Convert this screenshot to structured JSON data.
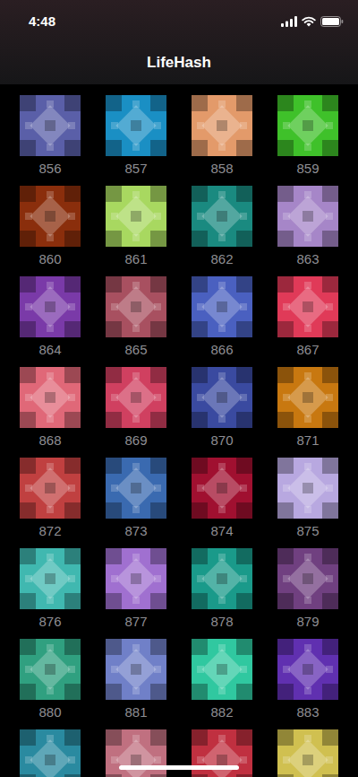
{
  "status_bar": {
    "time": "4:48"
  },
  "nav": {
    "title": "LifeHash"
  },
  "tiles": [
    {
      "number": "856",
      "color": "#5a5fa8"
    },
    {
      "number": "857",
      "color": "#1a8fc4"
    },
    {
      "number": "858",
      "color": "#e39a6a"
    },
    {
      "number": "859",
      "color": "#3fc12a"
    },
    {
      "number": "860",
      "color": "#8a2e0c"
    },
    {
      "number": "861",
      "color": "#a8d860"
    },
    {
      "number": "862",
      "color": "#1a8a80"
    },
    {
      "number": "863",
      "color": "#a686c8"
    },
    {
      "number": "864",
      "color": "#7a3aa8"
    },
    {
      "number": "865",
      "color": "#a85060"
    },
    {
      "number": "866",
      "color": "#4a60c0"
    },
    {
      "number": "867",
      "color": "#e03a58"
    },
    {
      "number": "868",
      "color": "#e06878"
    },
    {
      "number": "869",
      "color": "#d04060"
    },
    {
      "number": "870",
      "color": "#3a4aa0"
    },
    {
      "number": "871",
      "color": "#c87810"
    },
    {
      "number": "872",
      "color": "#c04040"
    },
    {
      "number": "873",
      "color": "#3a6ab0"
    },
    {
      "number": "874",
      "color": "#a01030"
    },
    {
      "number": "875",
      "color": "#b8a8e0"
    },
    {
      "number": "876",
      "color": "#40b8b0"
    },
    {
      "number": "877",
      "color": "#a070d0"
    },
    {
      "number": "878",
      "color": "#1a9a8a"
    },
    {
      "number": "879",
      "color": "#704080"
    },
    {
      "number": "880",
      "color": "#30a080"
    },
    {
      "number": "881",
      "color": "#7080c8"
    },
    {
      "number": "882",
      "color": "#30c8a0"
    },
    {
      "number": "883",
      "color": "#6030b0"
    },
    {
      "color": "#2a8aa0"
    },
    {
      "color": "#c07080"
    },
    {
      "color": "#c03040"
    },
    {
      "color": "#d0c050"
    }
  ]
}
